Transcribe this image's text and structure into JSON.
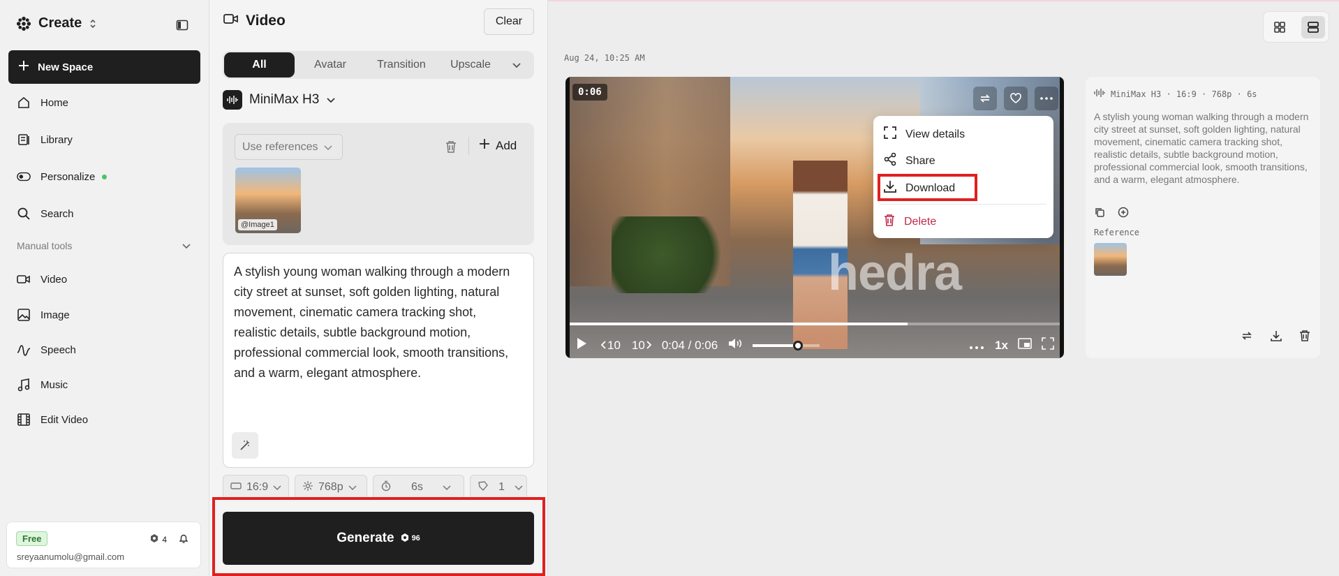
{
  "app": {
    "title": "Create"
  },
  "sidebar": {
    "new_space": "New Space",
    "items": [
      {
        "label": "Home"
      },
      {
        "label": "Library"
      },
      {
        "label": "Personalize"
      },
      {
        "label": "Search"
      }
    ],
    "section_label": "Manual tools",
    "tools": [
      {
        "label": "Video"
      },
      {
        "label": "Image"
      },
      {
        "label": "Speech"
      },
      {
        "label": "Music"
      },
      {
        "label": "Edit Video"
      }
    ],
    "account": {
      "plan": "Free",
      "credits": "4",
      "email": "sreyaanumolu@gmail.com"
    }
  },
  "panel": {
    "title": "Video",
    "clear_label": "Clear",
    "tabs": [
      "All",
      "Avatar",
      "Transition",
      "Upscale"
    ],
    "model": "MiniMax H3",
    "use_references": "Use references",
    "add_label": "Add",
    "reference_tag": "@Image1",
    "prompt": "A stylish young woman walking through a modern city street at sunset, soft golden lighting, natural movement, cinematic camera tracking shot, realistic details, subtle background motion, professional commercial look, smooth transitions, and a warm, elegant atmosphere.",
    "options": {
      "aspect": "16:9",
      "resolution": "768p",
      "duration": "6s",
      "count": "1"
    },
    "generate_label": "Generate",
    "generate_cost": "96"
  },
  "main": {
    "date": "Aug 24, 10:25 AM",
    "player": {
      "duration_badge": "0:06",
      "watermark": "hedra",
      "rewind": "10",
      "forward": "10",
      "time": "0:04 / 0:06",
      "speed": "1x",
      "progress": 0.69,
      "volume": 0.68
    },
    "menu": {
      "view_details": "View details",
      "share": "Share",
      "download": "Download",
      "delete": "Delete"
    },
    "detail": {
      "header": "MiniMax H3 · 16:9 · 768p · 6s",
      "prompt": "A stylish young woman walking through a modern city street at sunset, soft golden lighting, natural movement, cinematic camera tracking shot, realistic details, subtle background motion, professional commercial look, smooth transitions, and a warm, elegant atmosphere.",
      "reference_label": "Reference"
    }
  }
}
